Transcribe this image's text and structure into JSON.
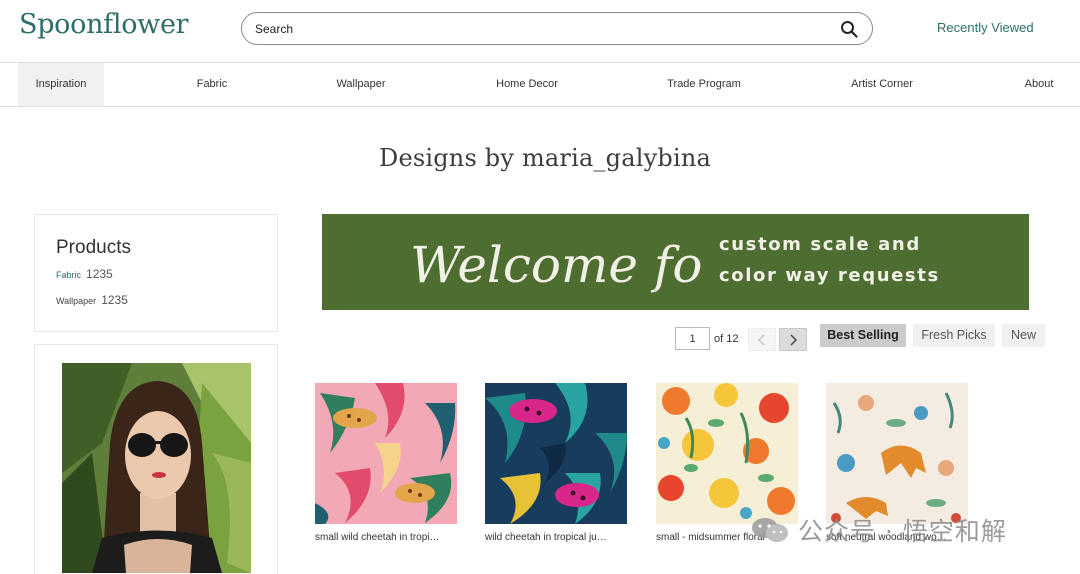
{
  "header": {
    "logo": "Spoonflower",
    "search_placeholder": "Search",
    "recently_viewed": "Recently Viewed"
  },
  "nav": {
    "items": [
      {
        "label": "Inspiration",
        "active": true
      },
      {
        "label": "Fabric"
      },
      {
        "label": "Wallpaper"
      },
      {
        "label": "Home Decor"
      },
      {
        "label": "Trade Program"
      },
      {
        "label": "Artist Corner"
      },
      {
        "label": "About"
      }
    ]
  },
  "page_title": "Designs by maria_galybina",
  "products": {
    "title": "Products",
    "rows": [
      {
        "label": "Fabric",
        "count": "1235"
      },
      {
        "label": "Wallpaper",
        "count": "1235"
      }
    ]
  },
  "banner": {
    "script": "Welcome for",
    "line1": "custom scale and",
    "line2": "color way requests",
    "color": "#4e6d30"
  },
  "pagination": {
    "current": "1",
    "of_label": "of 12"
  },
  "sort": {
    "best": "Best Selling",
    "fresh": "Fresh Picks",
    "new": "New",
    "active": "Best Selling"
  },
  "designs": [
    {
      "name": "small wild cheetah in tropical"
    },
    {
      "name": "wild cheetah in tropical jungle"
    },
    {
      "name": "small - midsummer floral"
    },
    {
      "name": "soft neutral woodland wonder"
    }
  ],
  "watermark": "公众号 · 悟空和解",
  "colors": {
    "brand": "#2d6e6a",
    "banner": "#4e6d30"
  }
}
